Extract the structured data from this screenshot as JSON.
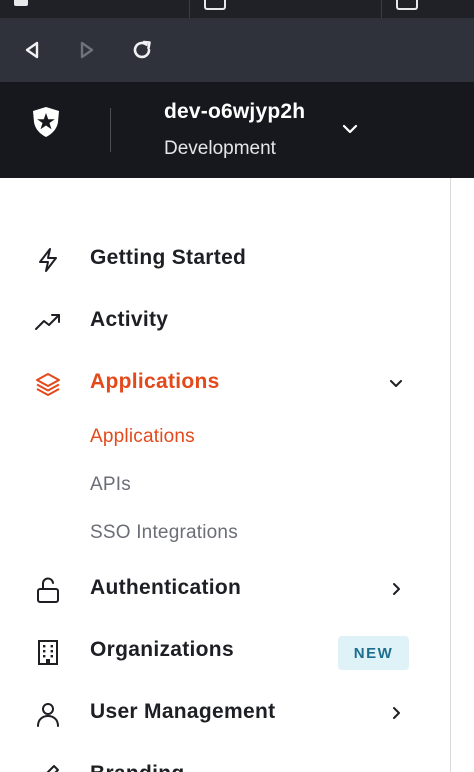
{
  "tenant": {
    "name": "dev-o6wjyp2h",
    "environment": "Development"
  },
  "nav": {
    "getting_started": "Getting Started",
    "activity": "Activity",
    "applications": "Applications",
    "applications_sub": [
      "Applications",
      "APIs",
      "SSO Integrations"
    ],
    "authentication": "Authentication",
    "organizations": "Organizations",
    "organizations_badge": "NEW",
    "user_management": "User Management",
    "branding": "Branding"
  },
  "colors": {
    "accent": "#e3491a",
    "header_bg": "#16181d",
    "toolbar_bg": "#2f323a",
    "badge_bg": "#dff2f8",
    "badge_text": "#1d6f8e"
  },
  "icons": {
    "back": "back-arrow-icon",
    "forward": "forward-arrow-icon",
    "reload": "reload-icon",
    "logo": "auth0-shield-logo",
    "getting_started": "lightning-icon",
    "activity": "trend-up-icon",
    "applications": "layers-icon",
    "authentication": "unlock-icon",
    "organizations": "building-icon",
    "user_management": "user-icon",
    "branding": "brush-icon"
  }
}
